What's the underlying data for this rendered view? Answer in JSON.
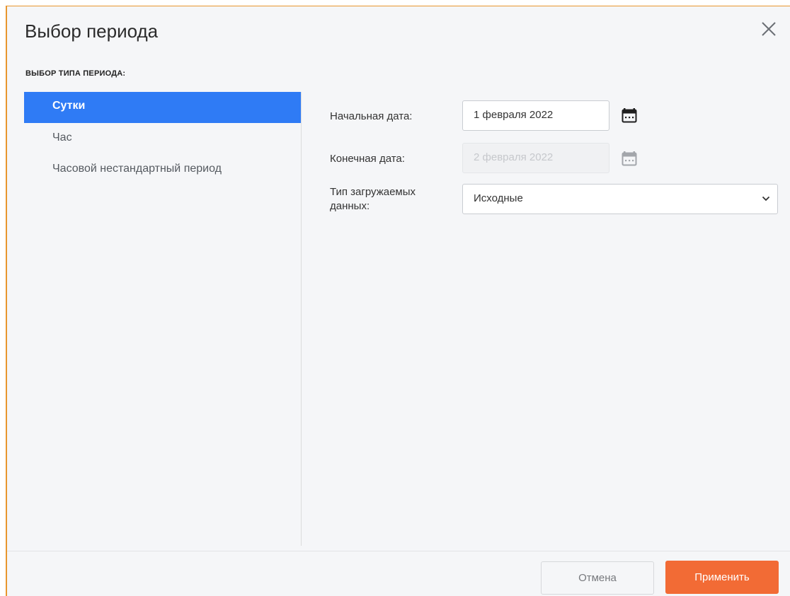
{
  "dialog": {
    "title": "Выбор периода",
    "close_icon": "close-icon"
  },
  "period_type": {
    "section_label": "ВЫБОР ТИПА ПЕРИОДА:",
    "items": [
      {
        "label": "Сутки",
        "selected": true
      },
      {
        "label": "Час",
        "selected": false
      },
      {
        "label": "Часовой нестандартный период",
        "selected": false
      }
    ]
  },
  "form": {
    "start_date": {
      "label": "Начальная дата:",
      "value": "1 февраля 2022",
      "icon": "calendar-icon"
    },
    "end_date": {
      "label": "Конечная дата:",
      "value": "2 февраля 2022",
      "disabled": true,
      "icon": "calendar-icon"
    },
    "data_type": {
      "label_line1": "Тип загружаемых",
      "label_line2": "данных:",
      "value": "Исходные"
    }
  },
  "footer": {
    "cancel_label": "Отмена",
    "apply_label": "Применить"
  },
  "colors": {
    "accent_selected": "#2f7bf5",
    "apply_button": "#f26b35",
    "dialog_border": "#e8962e"
  }
}
